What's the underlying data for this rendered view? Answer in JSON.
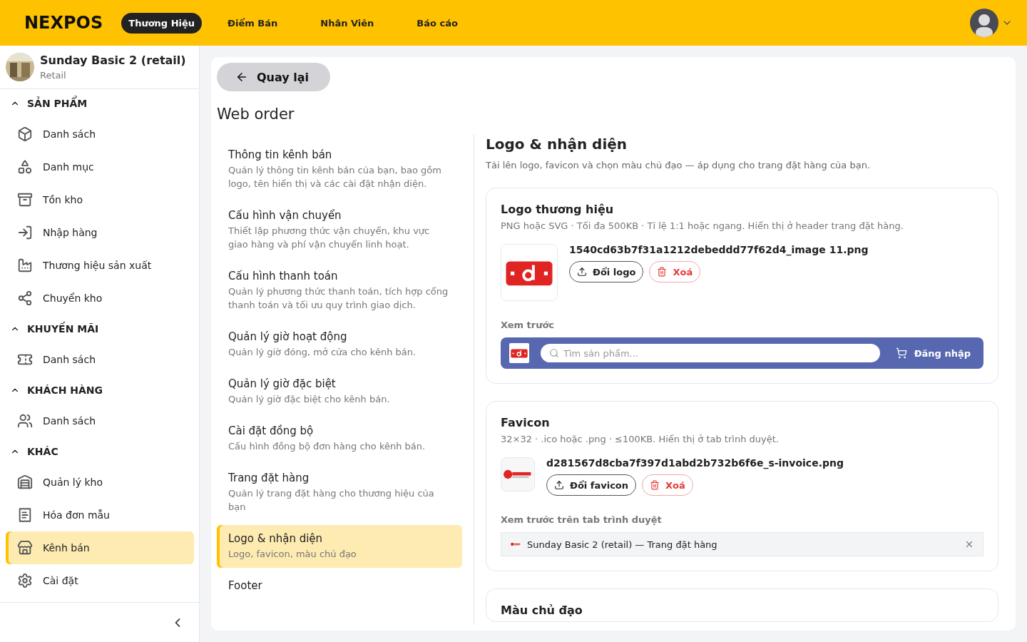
{
  "header": {
    "logo": "NEXPOS",
    "nav": [
      {
        "label": "Thương Hiệu",
        "selected": true
      },
      {
        "label": "Điểm Bán",
        "selected": false
      },
      {
        "label": "Nhân Viên",
        "selected": false
      },
      {
        "label": "Báo cáo",
        "selected": false
      }
    ]
  },
  "sidebar": {
    "store": {
      "name": "Sunday Basic 2 (retail)",
      "type": "Retail"
    },
    "sections": [
      {
        "title": "SẢN PHẨM",
        "expanded": true,
        "items": [
          {
            "label": "Danh sách",
            "selected": false
          },
          {
            "label": "Danh mục",
            "selected": false
          },
          {
            "label": "Tồn kho",
            "selected": false
          },
          {
            "label": "Nhập hàng",
            "selected": false
          },
          {
            "label": "Thương hiệu sản xuất",
            "selected": false
          },
          {
            "label": "Chuyển kho",
            "selected": false
          }
        ]
      },
      {
        "title": "KHUYẾN MÃI",
        "expanded": true,
        "items": [
          {
            "label": "Danh sách",
            "selected": false
          }
        ]
      },
      {
        "title": "KHÁCH HÀNG",
        "expanded": true,
        "items": [
          {
            "label": "Danh sách",
            "selected": false
          }
        ]
      },
      {
        "title": "KHÁC",
        "expanded": true,
        "items": [
          {
            "label": "Quản lý kho",
            "selected": false
          },
          {
            "label": "Hóa đơn mẫu",
            "selected": false
          },
          {
            "label": "Kênh bán",
            "selected": true
          },
          {
            "label": "Cài đặt",
            "selected": false
          }
        ]
      }
    ]
  },
  "main": {
    "back_button": "Quay lại",
    "title": "Web order",
    "settings_nav": [
      {
        "title": "Thông tin kênh bán",
        "description": "Quản lý thông tin kênh bán của bạn, bao gồm logo, tên hiển thị và các cài đặt nhận diện.",
        "selected": false
      },
      {
        "title": "Cấu hình vận chuyển",
        "description": "Thiết lập phương thức vận chuyển, khu vực giao hàng và phí vận chuyển linh hoạt.",
        "selected": false
      },
      {
        "title": "Cấu hình thanh toán",
        "description": "Quản lý phương thức thanh toán, tích hợp cổng thanh toán và tối ưu quy trình giao dịch.",
        "selected": false
      },
      {
        "title": "Quản lý giờ hoạt động",
        "description": "Quản lý giờ đóng, mở cửa cho kênh bán.",
        "selected": false
      },
      {
        "title": "Quản lý giờ đặc biệt",
        "description": "Quản lý giờ đặc biệt cho kênh bán.",
        "selected": false
      },
      {
        "title": "Cài đặt đồng bộ",
        "description": "Cấu hình đồng bộ đơn hàng cho kênh bán.",
        "selected": false
      },
      {
        "title": "Trang đặt hàng",
        "description": "Quản lý trang đặt hàng cho thương hiệu của bạn",
        "selected": false
      },
      {
        "title": "Logo & nhận diện",
        "description": "Logo, favicon, màu chủ đạo",
        "selected": true
      },
      {
        "title": "Footer",
        "selected": false
      }
    ],
    "section": {
      "title": "Logo & nhận diện",
      "description": "Tải lên logo, favicon và chọn màu chủ đạo — áp dụng cho trang đặt hàng của bạn."
    },
    "logo_card": {
      "title": "Logo thương hiệu",
      "description": "PNG hoặc SVG · Tối đa 500KB · Tỉ lệ 1:1 hoặc ngang. Hiển thị ở header trang đặt hàng.",
      "file_name": "1540cd63b7f31a1212debeddd77f62d4_image 11.png",
      "change_button": "Đổi logo",
      "delete_button": "Xoá",
      "preview_label": "Xem trước",
      "preview": {
        "search_placeholder": "Tìm sản phẩm...",
        "login_label": "Đăng nhập"
      }
    },
    "favicon_card": {
      "title": "Favicon",
      "description": "32×32 · .ico hoặc .png · ≤100KB. Hiển thị ở tab trình duyệt.",
      "file_name": "d281567d8cba7f397d1abd2b732b6f6e_s-invoice.png",
      "change_button": "Đổi favicon",
      "delete_button": "Xoá",
      "preview_label": "Xem trước trên tab trình duyệt",
      "tab_title": "Sunday Basic 2 (retail) — Trang đặt hàng"
    },
    "color_card": {
      "title": "Màu chủ đạo"
    }
  }
}
